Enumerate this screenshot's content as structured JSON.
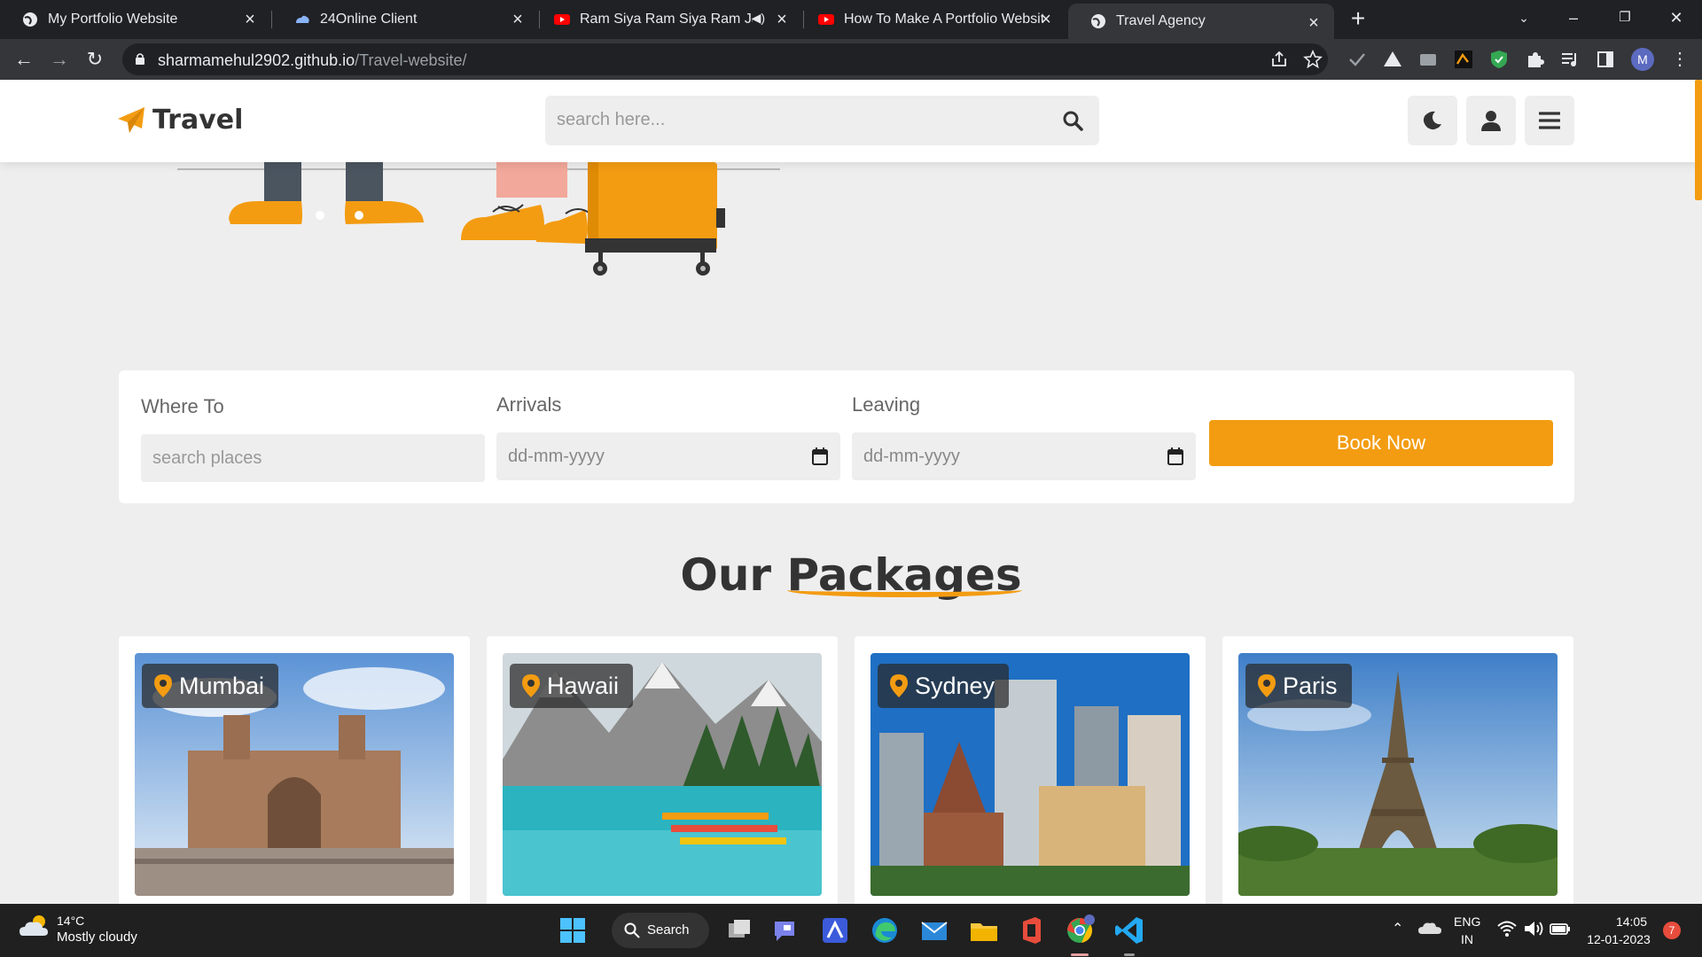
{
  "browser": {
    "tabs": [
      {
        "title": "My Portfolio Website",
        "icon": "globe-icon"
      },
      {
        "title": "24Online Client",
        "icon": "cloud-icon"
      },
      {
        "title": "Ram Siya Ram Siya Ram Jai J...",
        "icon": "youtube-icon"
      },
      {
        "title": "How To Make A Portfolio Website",
        "icon": "youtube-icon"
      },
      {
        "title": "Travel Agency",
        "icon": "globe-icon",
        "active": true
      }
    ],
    "url_host": "sharmamehul2902.github.io",
    "url_path": "/Travel-website/",
    "profile_initial": "M"
  },
  "site": {
    "logo_text": "Travel",
    "search_placeholder": "search here...",
    "accent_color": "#f39c12"
  },
  "booking": {
    "where_label": "Where To",
    "where_placeholder": "search places",
    "arrivals_label": "Arrivals",
    "arrivals_value": "dd-mm-yyyy",
    "leaving_label": "Leaving",
    "leaving_value": "dd-mm-yyyy",
    "button_label": "Book Now"
  },
  "packages": {
    "title_plain": "Our",
    "title_accent": "Packages",
    "items": [
      {
        "name": "Mumbai"
      },
      {
        "name": "Hawaii"
      },
      {
        "name": "Sydney"
      },
      {
        "name": "Paris"
      }
    ]
  },
  "taskbar": {
    "temp": "14°C",
    "weather": "Mostly cloudy",
    "search_label": "Search",
    "lang_top": "ENG",
    "lang_bottom": "IN",
    "time": "14:05",
    "date": "12-01-2023",
    "notifications": "7"
  }
}
